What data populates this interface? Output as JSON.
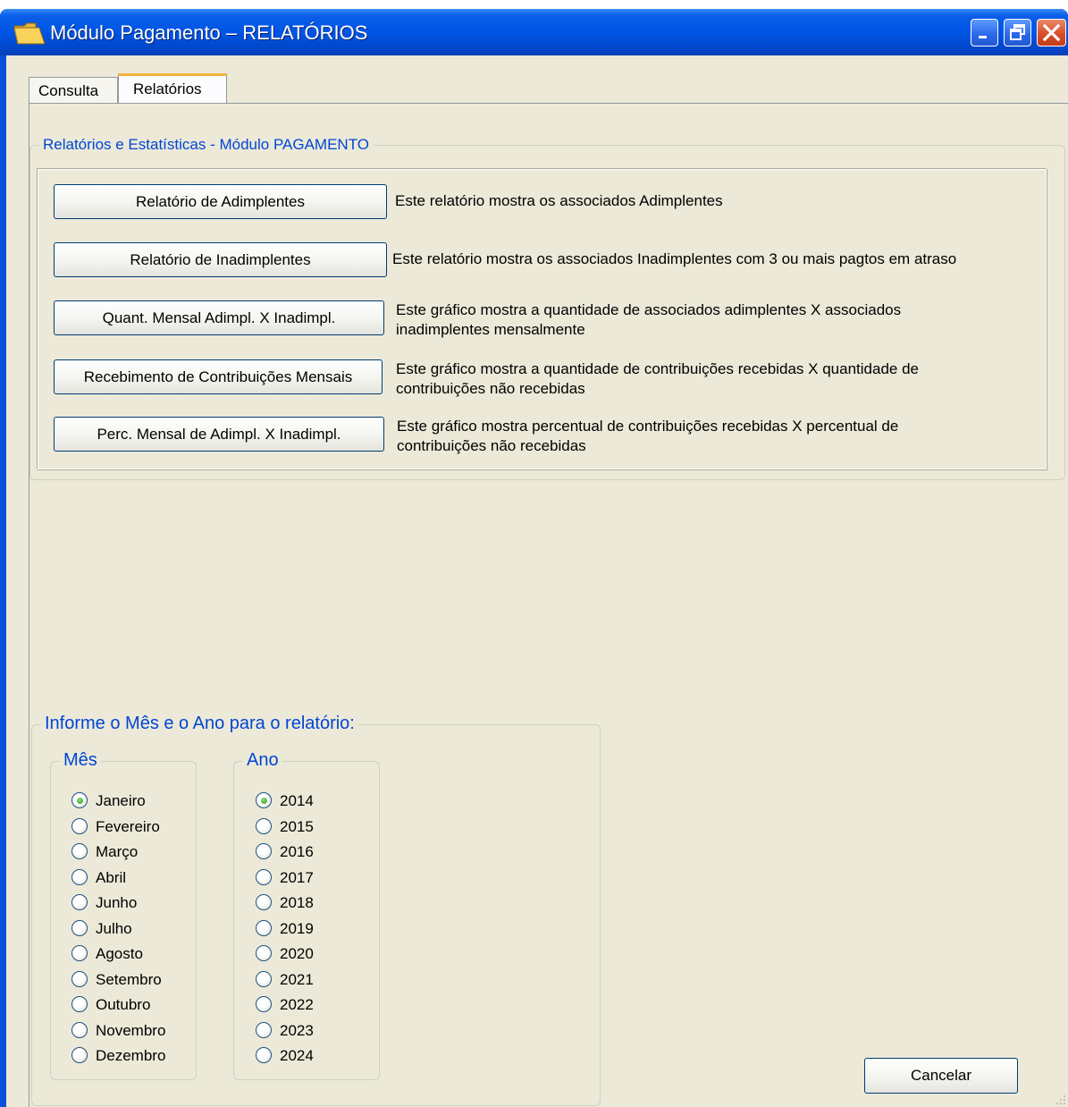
{
  "window": {
    "title": "Módulo Pagamento – RELATÓRIOS",
    "controls": [
      "minimize",
      "restore",
      "close"
    ]
  },
  "tabs": [
    {
      "label": "Consulta",
      "active": false
    },
    {
      "label": "Relatórios",
      "active": true
    }
  ],
  "reports_group": {
    "legend": "Relatórios e Estatísticas - Módulo PAGAMENTO",
    "items": [
      {
        "button": "Relatório de Adimplentes",
        "description_lines": [
          "Este relatório mostra os associados Adimplentes"
        ]
      },
      {
        "button": "Relatório de Inadimplentes",
        "description_lines": [
          "Este relatório mostra os associados Inadimplentes com 3 ou mais pagtos em atraso"
        ]
      },
      {
        "button": "Quant. Mensal Adimpl. X Inadimpl.",
        "description_lines": [
          "Este gráfico mostra a quantidade de associados adimplentes X associados",
          "inadimplentes mensalmente"
        ]
      },
      {
        "button": "Recebimento de Contribuições Mensais",
        "description_lines": [
          "Este gráfico mostra a quantidade de contribuições recebidas X quantidade de",
          "contribuições não recebidas"
        ]
      },
      {
        "button": "Perc. Mensal de Adimpl. X Inadimpl.",
        "description_lines": [
          "Este gráfico mostra percentual de contribuições recebidas X percentual de",
          "contribuições não recebidas"
        ]
      }
    ]
  },
  "period_group": {
    "legend": "Informe o Mês e o Ano para o relatório:",
    "month": {
      "legend": "Mês",
      "selected": "Janeiro",
      "options": [
        "Janeiro",
        "Fevereiro",
        "Março",
        "Abril",
        "Junho",
        "Julho",
        "Agosto",
        "Setembro",
        "Outubro",
        "Novembro",
        "Dezembro"
      ]
    },
    "year": {
      "legend": "Ano",
      "selected": "2014",
      "options": [
        "2014",
        "2015",
        "2016",
        "2017",
        "2018",
        "2019",
        "2020",
        "2021",
        "2022",
        "2023",
        "2024"
      ]
    }
  },
  "cancel_label": "Cancelar",
  "colors": {
    "titlebar": "#0055e5",
    "legend_text": "#0046d5",
    "client_bg": "#ece9d8",
    "active_tab_accent": "#f5b33f",
    "radio_selected": "#21a121"
  }
}
